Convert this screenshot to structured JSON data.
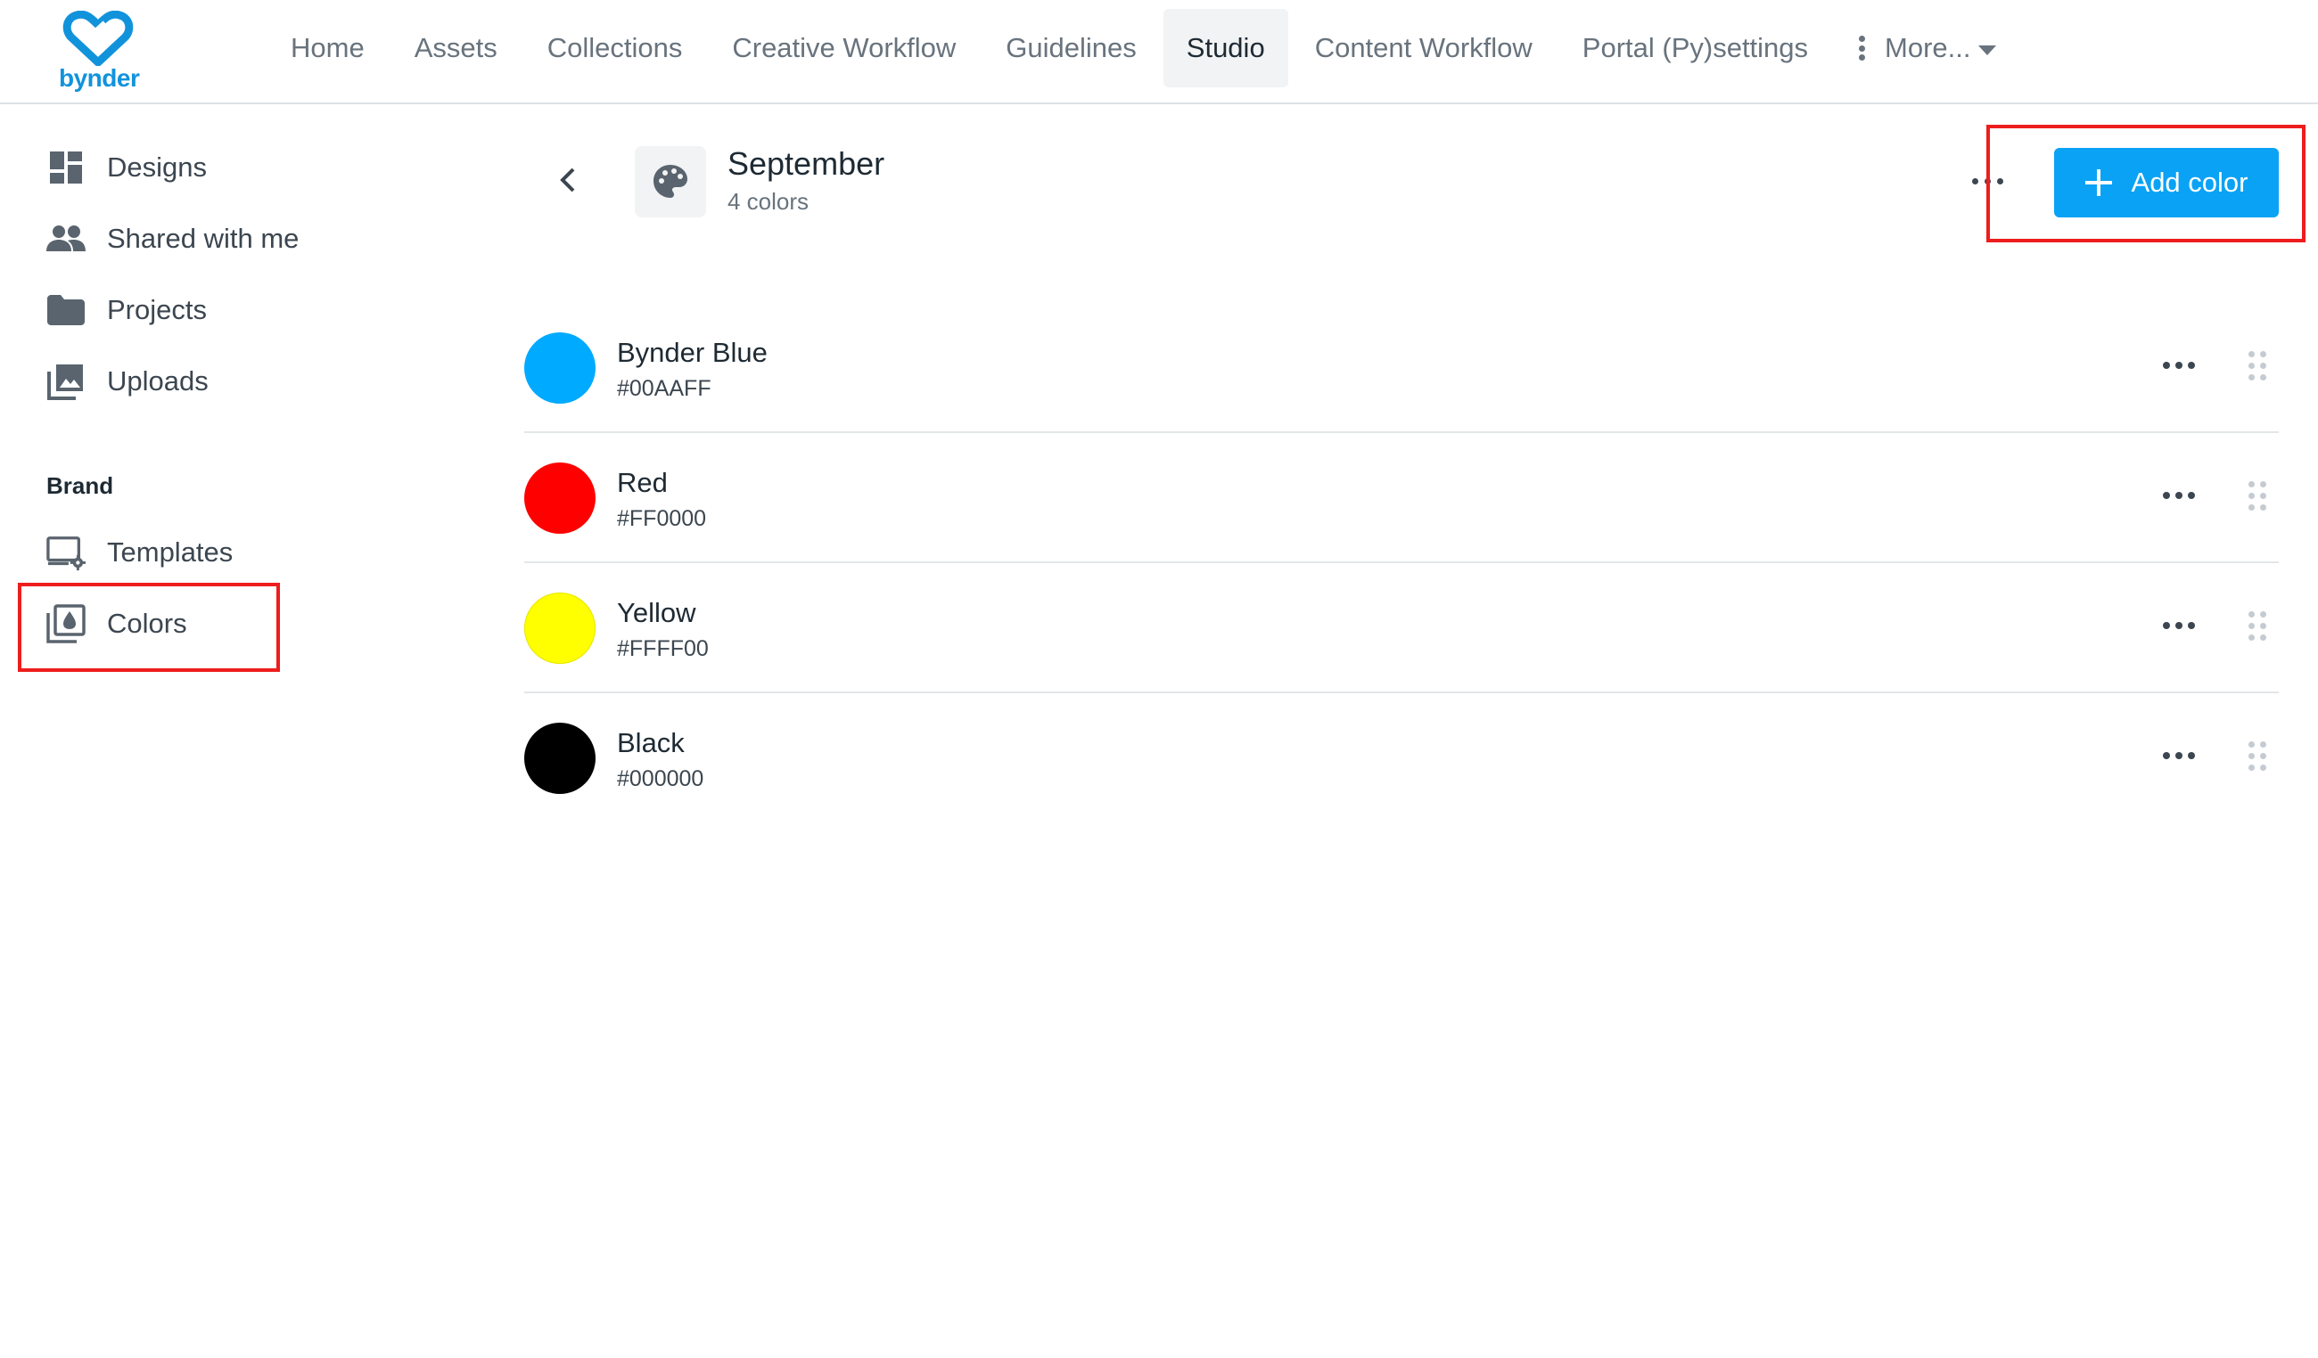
{
  "brand": {
    "logo_text": "bynder"
  },
  "nav": {
    "items": [
      {
        "label": "Home"
      },
      {
        "label": "Assets"
      },
      {
        "label": "Collections"
      },
      {
        "label": "Creative Workflow"
      },
      {
        "label": "Guidelines"
      },
      {
        "label": "Studio",
        "active": true
      },
      {
        "label": "Content Workflow"
      },
      {
        "label": "Portal (Py)settings"
      }
    ],
    "more_label": "More..."
  },
  "sidebar": {
    "items": [
      {
        "label": "Designs",
        "icon": "dashboard-icon"
      },
      {
        "label": "Shared with me",
        "icon": "people-icon"
      },
      {
        "label": "Projects",
        "icon": "folder-icon"
      },
      {
        "label": "Uploads",
        "icon": "image-stack-icon"
      }
    ],
    "brand_heading": "Brand",
    "brand_items": [
      {
        "label": "Templates",
        "icon": "monitor-gear-icon"
      },
      {
        "label": "Colors",
        "icon": "color-drop-icon",
        "highlighted": true
      }
    ]
  },
  "collection": {
    "title": "September",
    "count": "4 colors",
    "icon": "palette-icon"
  },
  "actions": {
    "add_color_label": "Add color"
  },
  "colors": [
    {
      "name": "Bynder Blue",
      "hex": "#00AAFF"
    },
    {
      "name": "Red",
      "hex": "#FF0000"
    },
    {
      "name": "Yellow",
      "hex": "#FFFF00"
    },
    {
      "name": "Black",
      "hex": "#000000"
    }
  ],
  "theme": {
    "accent": "#0AA2F5",
    "highlight": "#EE1D1D",
    "logo": "#1193DC"
  }
}
